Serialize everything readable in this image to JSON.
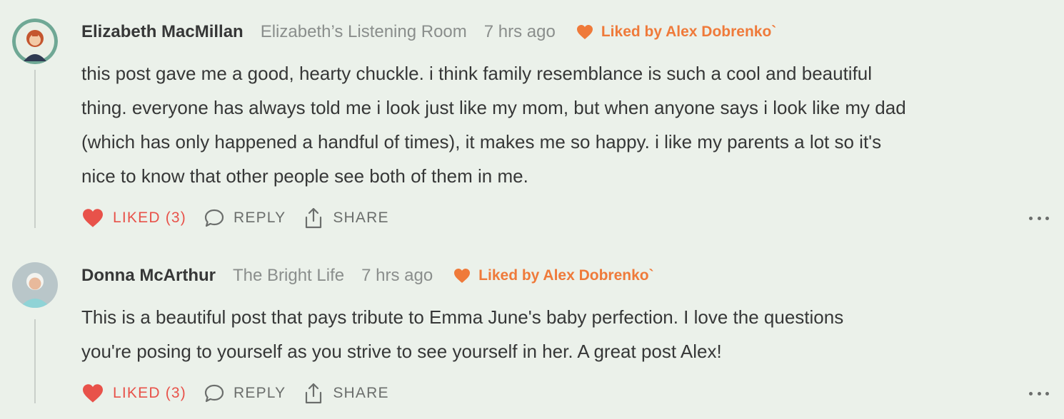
{
  "comments": [
    {
      "author": "Elizabeth MacMillan",
      "publication": "Elizabeth’s Listening Room",
      "time": "7 hrs ago",
      "liked_by": "Liked by Alex Dobrenko`",
      "body": "this post gave me a good, hearty chuckle. i think family resemblance is such a cool and beautiful thing. everyone has always told me i look just like my mom, but when anyone says i look like my dad (which has only happened a handful of times), it makes me so happy. i like my parents a lot so it's nice to know that other people see both of them in me.",
      "body_lines": [
        "this post gave me a good, hearty chuckle. i think family resemblance is such a cool and beautiful",
        "thing. everyone has always told me i look just like my mom, but when anyone says i look like my dad",
        "(which has only happened a handful of times), it makes me so happy. i like my parents a lot so it's",
        "nice to know that other people see both of them in me."
      ],
      "like_label": "LIKED (3)",
      "reply_label": "REPLY",
      "share_label": "SHARE"
    },
    {
      "author": "Donna McArthur",
      "publication": "The Bright Life",
      "time": "7 hrs ago",
      "liked_by": "Liked by Alex Dobrenko`",
      "body_lines": [
        "This is a beautiful post that pays tribute to Emma June's baby perfection. I love the questions",
        "you're posing to yourself as you strive to see yourself in her. A great post Alex!"
      ],
      "like_label": "LIKED (3)",
      "reply_label": "REPLY",
      "share_label": "SHARE"
    }
  ],
  "colors": {
    "background": "#ebf1ea",
    "liked": "#e8524a",
    "author_like": "#ef7a3a",
    "muted": "#8a8e8c"
  },
  "icons": [
    "heart-icon",
    "comment-icon",
    "share-icon",
    "more-icon"
  ]
}
